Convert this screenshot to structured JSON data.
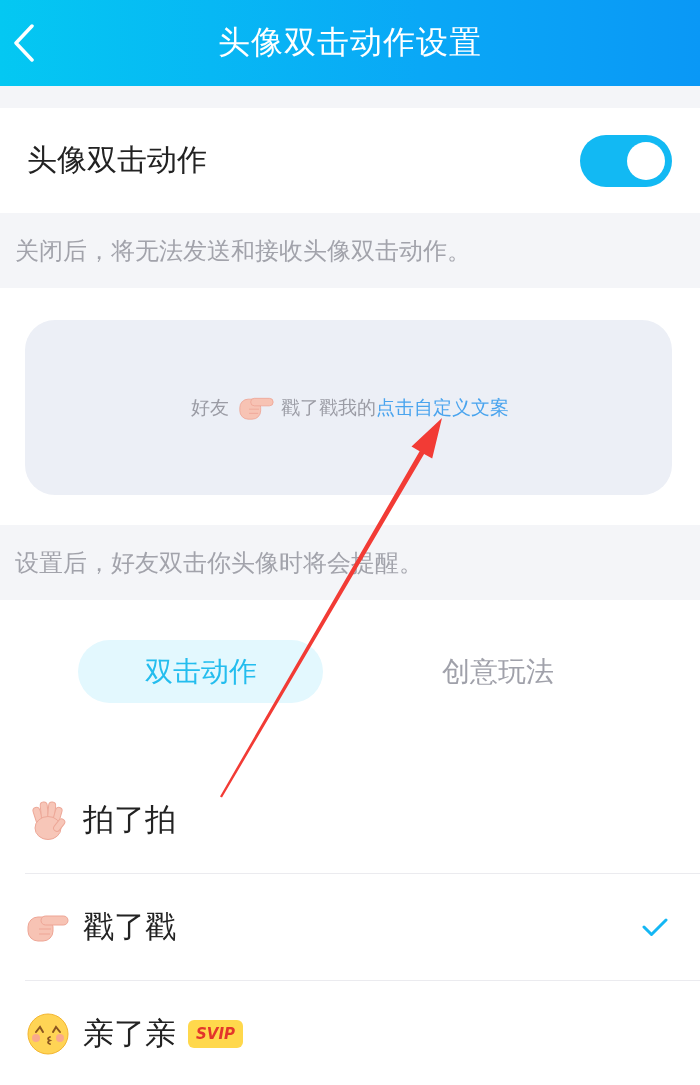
{
  "header": {
    "title": "头像双击动作设置"
  },
  "toggle_row": {
    "label": "头像双击动作",
    "on": true
  },
  "toggle_hint": "关闭后，将无法发送和接收头像双击动作。",
  "preview": {
    "prefix": "好友",
    "action": "戳了戳我的",
    "link": "点击自定义文案"
  },
  "preview_hint": "设置后，好友双击你头像时将会提醒。",
  "tabs": [
    {
      "label": "双击动作",
      "selected": true
    },
    {
      "label": "创意玩法",
      "selected": false
    }
  ],
  "actions": [
    {
      "kind": "wave",
      "label": "拍了拍",
      "selected": false
    },
    {
      "kind": "point",
      "label": "戳了戳",
      "selected": true
    },
    {
      "kind": "kiss",
      "label": "亲了亲",
      "selected": false,
      "badge": "SVIP"
    }
  ]
}
